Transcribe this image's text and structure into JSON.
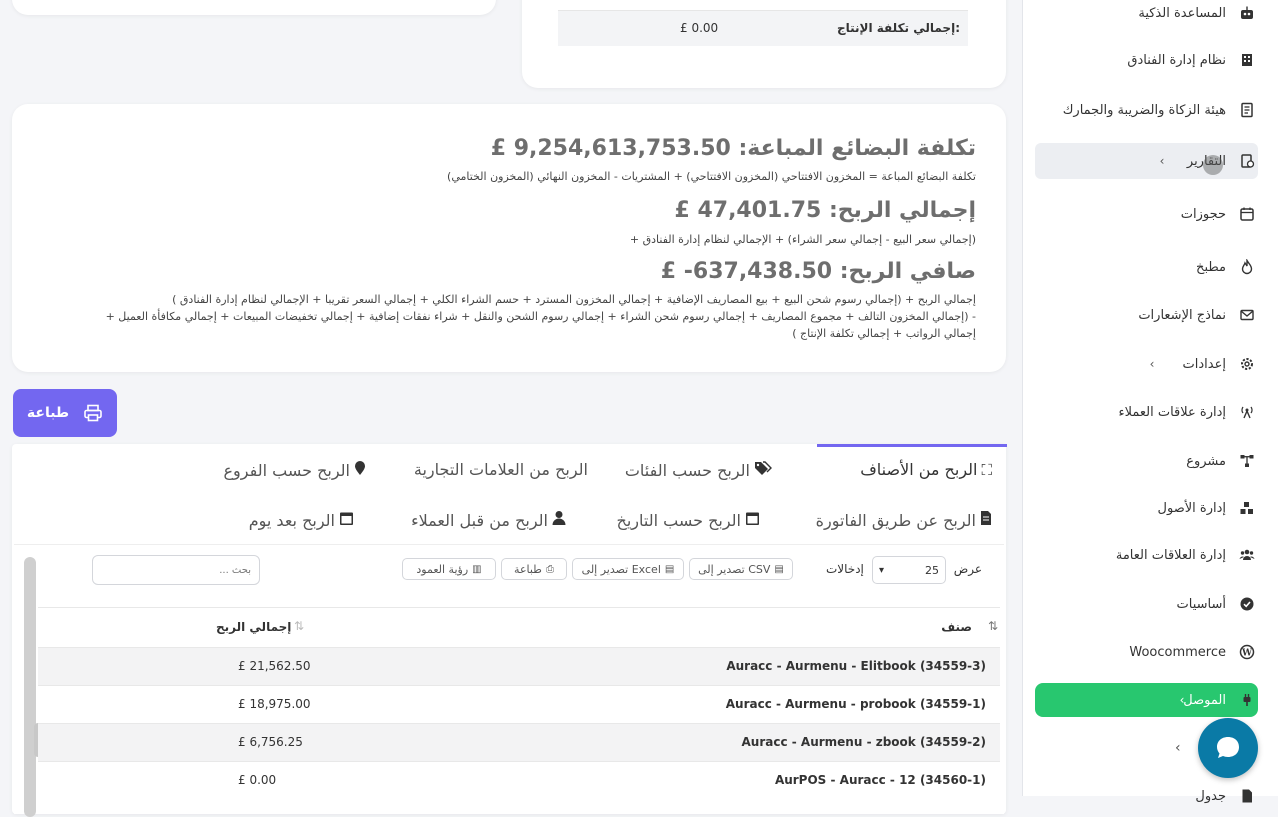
{
  "sidebar": {
    "items": [
      {
        "label": "المساعدة الذكية",
        "icon": "robot-icon"
      },
      {
        "label": "نظام إدارة الفنادق",
        "icon": "hotel-icon"
      },
      {
        "label": "هيئة الزكاة والضريبة والجمارك",
        "icon": "receipt-icon"
      },
      {
        "label": "التقارير",
        "icon": "report-icon"
      },
      {
        "label": "حجوزات",
        "icon": "calendar-icon"
      },
      {
        "label": "مطبخ",
        "icon": "fire-icon"
      },
      {
        "label": "نماذج الإشعارات",
        "icon": "envelope-icon"
      },
      {
        "label": "إعدادات",
        "icon": "gear-icon"
      },
      {
        "label": "إدارة علاقات العملاء",
        "icon": "broadcast-icon"
      },
      {
        "label": "مشروع",
        "icon": "sitemap-icon"
      },
      {
        "label": "إدارة الأصول",
        "icon": "boxes-icon"
      },
      {
        "label": "إدارة العلاقات العامة",
        "icon": "users-icon"
      },
      {
        "label": "أساسيات",
        "icon": "check-circle-icon"
      },
      {
        "label": "Woocommerce",
        "icon": "wordpress-icon"
      },
      {
        "label": "الموصل",
        "icon": "plug-icon"
      },
      {
        "label": "جدول",
        "icon": "file-icon"
      }
    ]
  },
  "top_card": {
    "label": "إجمالي تكلفة الإنتاج:",
    "value": "£ 0.00"
  },
  "summary": {
    "cogs_title": "تكلفة البضائع المباعة:",
    "cogs_value": "£ 9,254,613,753.50",
    "cogs_formula": "تكلفة البضائع المباعة = المخزون الافتتاحي (المخزون الافتتاحي) + المشتريات - المخزون النهائي (المخزون الختامي)",
    "gross_title": "إجمالي الربح:",
    "gross_value": "£ 47,401.75",
    "gross_formula": "(إجمالي سعر البيع - إجمالي سعر الشراء) + الإجمالي لنظام إدارة الفنادق +",
    "net_title": "صافي الربح:",
    "net_value": "£ -637,438.50",
    "net_formula_1": "إجمالي الربح + (إجمالي رسوم شحن البيع + بيع المصاريف الإضافية + إجمالي المخزون المسترد + حسم الشراء الكلي + إجمالي السعر تقريبا + الإجمالي لنظام إدارة الفنادق )",
    "net_formula_2": "- (إجمالي المخزون التالف + مجموع المصاريف + إجمالي رسوم شحن الشراء + إجمالي رسوم الشحن والنقل + شراء نفقات إضافية + إجمالي تخفيضات المبيعات + إجمالي مكافأة العميل +",
    "net_formula_3": "إجمالي الرواتب + إجمالي تكلفة الإنتاج )"
  },
  "print_button": "طباعة",
  "tabs": [
    {
      "label": "الربح من الأصناف",
      "icon": "cubes-icon"
    },
    {
      "label": "الربح حسب الفئات",
      "icon": "tags-icon"
    },
    {
      "label": "الربح من العلامات التجارية",
      "icon": ""
    },
    {
      "label": "الربح حسب الفروع",
      "icon": "map-marker-icon"
    },
    {
      "label": "الربح عن طريق الفاتورة",
      "icon": "file-invoice-icon"
    },
    {
      "label": "الربح حسب التاريخ",
      "icon": "calendar-icon"
    },
    {
      "label": "الربح من قبل العملاء",
      "icon": "user-icon"
    },
    {
      "label": "الربح بعد يوم",
      "icon": "calendar-icon"
    }
  ],
  "table_controls": {
    "show_label": "عرض",
    "entries_value": "25",
    "entries_label": "إدخالات",
    "export_csv": "تصدير إلى CSV",
    "export_excel": "تصدير إلى Excel",
    "print": "طباعة",
    "column_visibility": "رؤية العمود",
    "search_placeholder": "بحث ..."
  },
  "table": {
    "headers": [
      "صنف",
      "إجمالي الربح"
    ],
    "rows": [
      {
        "item": "Auracc - Aurmenu - Elitbook (34559-3)",
        "profit": "£ 21,562.50"
      },
      {
        "item": "Auracc - Aurmenu - probook (34559-1)",
        "profit": "£ 18,975.00"
      },
      {
        "item": "Auracc - Aurmenu - zbook (34559-2)",
        "profit": "£ 6,756.25"
      },
      {
        "item": "AurPOS - Auracc - 12 (34560-1)",
        "profit": "£ 0.00"
      }
    ]
  },
  "colors": {
    "accent": "#7367f0",
    "green": "#28c76f",
    "chat": "#0a7aa6"
  }
}
